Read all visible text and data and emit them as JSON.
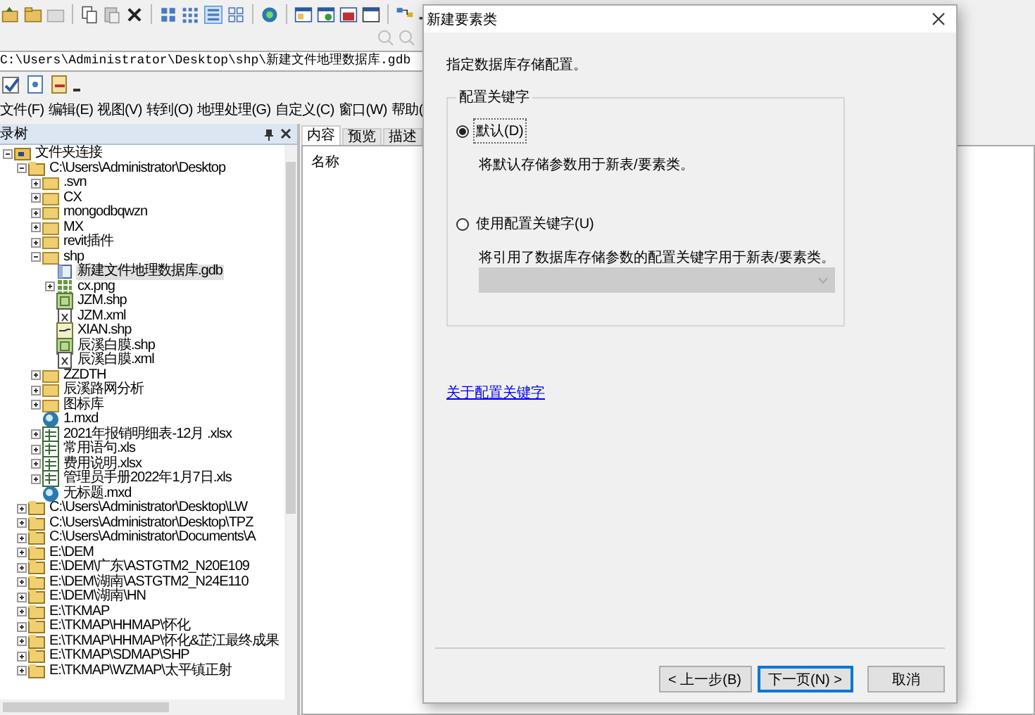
{
  "address_bar": {
    "value": "C:\\Users\\Administrator\\Desktop\\shp\\新建文件地理数据库.gdb"
  },
  "menu": [
    "文件(F)",
    "编辑(E)",
    "视图(V)",
    "转到(O)",
    "地理处理(G)",
    "自定义(C)",
    "窗口(W)",
    "帮助("
  ],
  "catalog_tree": {
    "title": "录树",
    "items": [
      {
        "label": "文件夹连接",
        "kind": "connection-root",
        "expanded": true,
        "selected": false,
        "children": [
          {
            "label": "C:\\Users\\Administrator\\Desktop",
            "kind": "connection",
            "expanded": true,
            "selected": false,
            "children": [
              {
                "label": ".svn",
                "kind": "folder",
                "expanded": false,
                "selected": false
              },
              {
                "label": "CX",
                "kind": "folder",
                "expanded": false,
                "selected": false
              },
              {
                "label": "mongodbqwzn",
                "kind": "folder",
                "expanded": false,
                "selected": false
              },
              {
                "label": "MX",
                "kind": "folder",
                "expanded": false,
                "selected": false
              },
              {
                "label": "revit插件",
                "kind": "folder",
                "expanded": false,
                "selected": false
              },
              {
                "label": "shp",
                "kind": "folder",
                "expanded": true,
                "selected": false,
                "children": [
                  {
                    "label": "新建文件地理数据库.gdb",
                    "kind": "gdb",
                    "selected": true
                  },
                  {
                    "label": "cx.png",
                    "kind": "raster",
                    "expanded": false,
                    "selected": false
                  },
                  {
                    "label": "JZM.shp",
                    "kind": "polygon-shp",
                    "selected": false
                  },
                  {
                    "label": "JZM.xml",
                    "kind": "xml",
                    "selected": false
                  },
                  {
                    "label": "XIAN.shp",
                    "kind": "line-shp",
                    "selected": false
                  },
                  {
                    "label": "辰溪白膜.shp",
                    "kind": "polygon-shp",
                    "selected": false
                  },
                  {
                    "label": "辰溪白膜.xml",
                    "kind": "xml",
                    "selected": false
                  }
                ]
              },
              {
                "label": "ZZDTH",
                "kind": "folder",
                "expanded": false,
                "selected": false
              },
              {
                "label": "辰溪路网分析",
                "kind": "folder",
                "expanded": false,
                "selected": false
              },
              {
                "label": "图标库",
                "kind": "folder",
                "expanded": false,
                "selected": false
              },
              {
                "label": "1.mxd",
                "kind": "mxd",
                "selected": false
              },
              {
                "label": "2021年报销明细表-12月 .xlsx",
                "kind": "table",
                "expanded": false,
                "selected": false
              },
              {
                "label": "常用语句.xls",
                "kind": "table",
                "expanded": false,
                "selected": false
              },
              {
                "label": "费用说明.xlsx",
                "kind": "table",
                "expanded": false,
                "selected": false
              },
              {
                "label": "管理员手册2022年1月7日.xls",
                "kind": "table",
                "expanded": false,
                "selected": false
              },
              {
                "label": "无标题.mxd",
                "kind": "mxd",
                "selected": false
              }
            ]
          },
          {
            "label": "C:\\Users\\Administrator\\Desktop\\LW",
            "kind": "connection",
            "expanded": false,
            "selected": false
          },
          {
            "label": "C:\\Users\\Administrator\\Desktop\\TPZ",
            "kind": "connection",
            "expanded": false,
            "selected": false
          },
          {
            "label": "C:\\Users\\Administrator\\Documents\\A",
            "kind": "connection",
            "expanded": false,
            "selected": false
          },
          {
            "label": "E:\\DEM",
            "kind": "connection",
            "expanded": false,
            "selected": false
          },
          {
            "label": "E:\\DEM\\广东\\ASTGTM2_N20E109",
            "kind": "connection",
            "expanded": false,
            "selected": false
          },
          {
            "label": "E:\\DEM\\湖南\\ASTGTM2_N24E110",
            "kind": "connection",
            "expanded": false,
            "selected": false
          },
          {
            "label": "E:\\DEM\\湖南\\HN",
            "kind": "connection",
            "expanded": false,
            "selected": false
          },
          {
            "label": "E:\\TKMAP",
            "kind": "connection",
            "expanded": false,
            "selected": false
          },
          {
            "label": "E:\\TKMAP\\HHMAP\\怀化",
            "kind": "connection",
            "expanded": false,
            "selected": false
          },
          {
            "label": "E:\\TKMAP\\HHMAP\\怀化&芷江最终成果",
            "kind": "connection",
            "expanded": false,
            "selected": false
          },
          {
            "label": "E:\\TKMAP\\SDMAP\\SHP",
            "kind": "connection",
            "expanded": false,
            "selected": false
          },
          {
            "label": "E:\\TKMAP\\WZMAP\\太平镇正射",
            "kind": "connection",
            "expanded": false,
            "selected": false
          }
        ]
      }
    ]
  },
  "content_pane": {
    "tabs": [
      {
        "label": "内容",
        "selected": true
      },
      {
        "label": "预览",
        "selected": false
      },
      {
        "label": "描述",
        "selected": false
      }
    ],
    "column_1": "名称"
  },
  "dialog": {
    "title": "新建要素类",
    "instruction": "指定数据库存储配置。",
    "group_label": "配置关键字",
    "options": [
      {
        "label": "默认(D)",
        "description": "将默认存储参数用于新表/要素类。",
        "selected": true
      },
      {
        "label": "使用配置关键字(U)",
        "description": "将引用了数据库存储参数的配置关键字用于新表/要素类。",
        "selected": false
      }
    ],
    "dropdown": {
      "disabled": true
    },
    "link": "关于配置关键字",
    "buttons": [
      {
        "label": "< 上一步(B)",
        "focused": false
      },
      {
        "label": "下一页(N) >",
        "focused": true
      },
      {
        "label": "取消",
        "focused": false
      }
    ]
  }
}
